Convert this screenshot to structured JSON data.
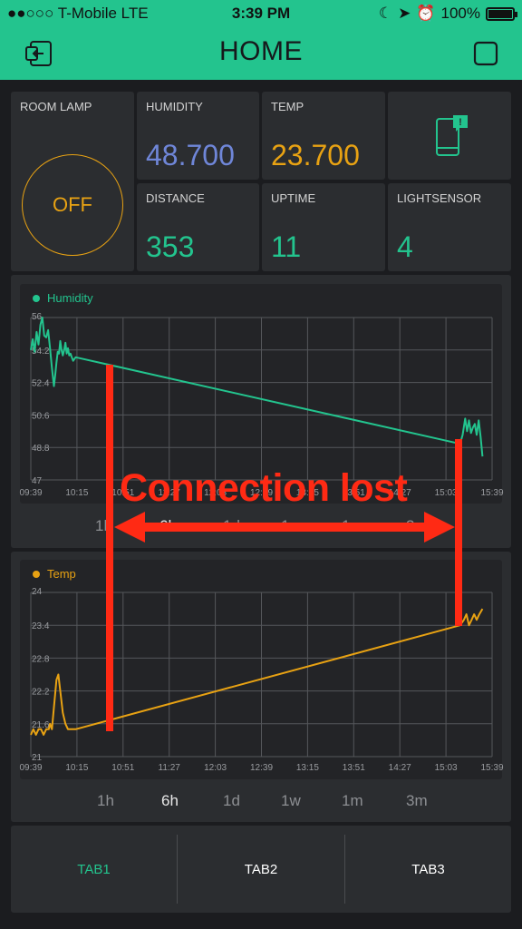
{
  "status_bar": {
    "carrier": "●●○○○ T-Mobile  LTE",
    "time": "3:39 PM",
    "battery": "100%"
  },
  "header": {
    "title": "HOME"
  },
  "widgets": {
    "room_lamp": {
      "label": "ROOM LAMP",
      "button_text": "OFF"
    },
    "humidity": {
      "label": "HUMIDITY",
      "value": "48.700",
      "color": "#6f86d8"
    },
    "temp": {
      "label": "TEMP",
      "value": "23.700",
      "color": "#e8a213"
    },
    "distance": {
      "label": "DISTANCE",
      "value": "353",
      "color": "#23c48e"
    },
    "uptime": {
      "label": "UPTIME",
      "value": "11",
      "color": "#23c48e"
    },
    "lightsensor": {
      "label": "LIGHTSENSOR",
      "value": "4",
      "color": "#23c48e"
    },
    "notification_icon": "phone-notification-icon"
  },
  "chart_data": [
    {
      "type": "line",
      "series": [
        {
          "name": "Humidity",
          "color": "#23c48e",
          "points": [
            [
              0,
              54.2
            ],
            [
              3,
              54.8
            ],
            [
              6,
              54.1
            ],
            [
              9,
              55.2
            ],
            [
              12,
              54.5
            ],
            [
              15,
              55.6
            ],
            [
              18,
              56.0
            ],
            [
              21,
              55.0
            ],
            [
              24,
              54.9
            ],
            [
              27,
              55.3
            ],
            [
              30,
              54.3
            ],
            [
              33,
              53.2
            ],
            [
              36,
              52.2
            ],
            [
              38,
              52.8
            ],
            [
              40,
              53.5
            ],
            [
              42,
              54.1
            ],
            [
              44,
              54.0
            ],
            [
              46,
              54.7
            ],
            [
              48,
              54.2
            ],
            [
              50,
              53.9
            ],
            [
              52,
              54.2
            ],
            [
              54,
              54.6
            ],
            [
              56,
              54.0
            ],
            [
              58,
              54.3
            ],
            [
              60,
              53.9
            ],
            [
              62,
              54.0
            ],
            [
              64,
              53.8
            ],
            [
              66,
              53.6
            ],
            [
              70,
              53.8
            ],
            [
              670,
              49.0
            ],
            [
              674,
              49.5
            ],
            [
              678,
              50.4
            ],
            [
              681,
              49.7
            ],
            [
              684,
              50.3
            ],
            [
              687,
              49.6
            ],
            [
              690,
              49.9
            ],
            [
              693,
              50.1
            ],
            [
              696,
              49.5
            ],
            [
              699,
              50.3
            ],
            [
              702,
              49.4
            ],
            [
              705,
              48.3
            ]
          ]
        }
      ],
      "x_tick_labels": [
        "09:39",
        "10:15",
        "10:51",
        "11:27",
        "12:03",
        "12:39",
        "13:15",
        "13:51",
        "14:27",
        "15:03",
        "15:39"
      ],
      "y_tick_labels": [
        "56",
        "54.2",
        "52.4",
        "50.6",
        "48.8",
        "47"
      ],
      "ylim": [
        47,
        56
      ],
      "x_range_minutes": [
        0,
        720
      ],
      "grid": true,
      "legend_position": "top-left"
    },
    {
      "type": "line",
      "series": [
        {
          "name": "Temp",
          "color": "#e8a213",
          "points": [
            [
              0,
              21.4
            ],
            [
              4,
              21.5
            ],
            [
              8,
              21.4
            ],
            [
              12,
              21.5
            ],
            [
              16,
              21.5
            ],
            [
              20,
              21.4
            ],
            [
              24,
              21.5
            ],
            [
              28,
              21.5
            ],
            [
              30,
              21.6
            ],
            [
              33,
              21.5
            ],
            [
              36,
              21.9
            ],
            [
              40,
              22.4
            ],
            [
              43,
              22.5
            ],
            [
              46,
              22.2
            ],
            [
              50,
              21.8
            ],
            [
              54,
              21.6
            ],
            [
              58,
              21.5
            ],
            [
              62,
              21.5
            ],
            [
              66,
              21.5
            ],
            [
              70,
              21.5
            ],
            [
              670,
              23.4
            ],
            [
              676,
              23.5
            ],
            [
              680,
              23.6
            ],
            [
              684,
              23.4
            ],
            [
              688,
              23.5
            ],
            [
              692,
              23.6
            ],
            [
              696,
              23.5
            ],
            [
              700,
              23.6
            ],
            [
              705,
              23.7
            ]
          ]
        }
      ],
      "x_tick_labels": [
        "09:39",
        "10:15",
        "10:51",
        "11:27",
        "12:03",
        "12:39",
        "13:15",
        "13:51",
        "14:27",
        "15:03",
        "15:39"
      ],
      "y_tick_labels": [
        "24",
        "23.4",
        "22.8",
        "22.2",
        "21.6",
        "21"
      ],
      "ylim": [
        21,
        24
      ],
      "x_range_minutes": [
        0,
        720
      ],
      "grid": true,
      "legend_position": "top-left"
    }
  ],
  "range_buttons": [
    "1h",
    "6h",
    "1d",
    "1w",
    "1m",
    "3m"
  ],
  "range_selected": "6h",
  "annotation": {
    "text": "Connection lost",
    "color": "#ff2a14"
  },
  "tabs": [
    {
      "label": "TAB1",
      "active": true
    },
    {
      "label": "TAB2",
      "active": false
    },
    {
      "label": "TAB3",
      "active": false
    }
  ],
  "colors": {
    "accent": "#23c48e",
    "panel": "#2b2d30",
    "background": "#1b1c1f"
  }
}
